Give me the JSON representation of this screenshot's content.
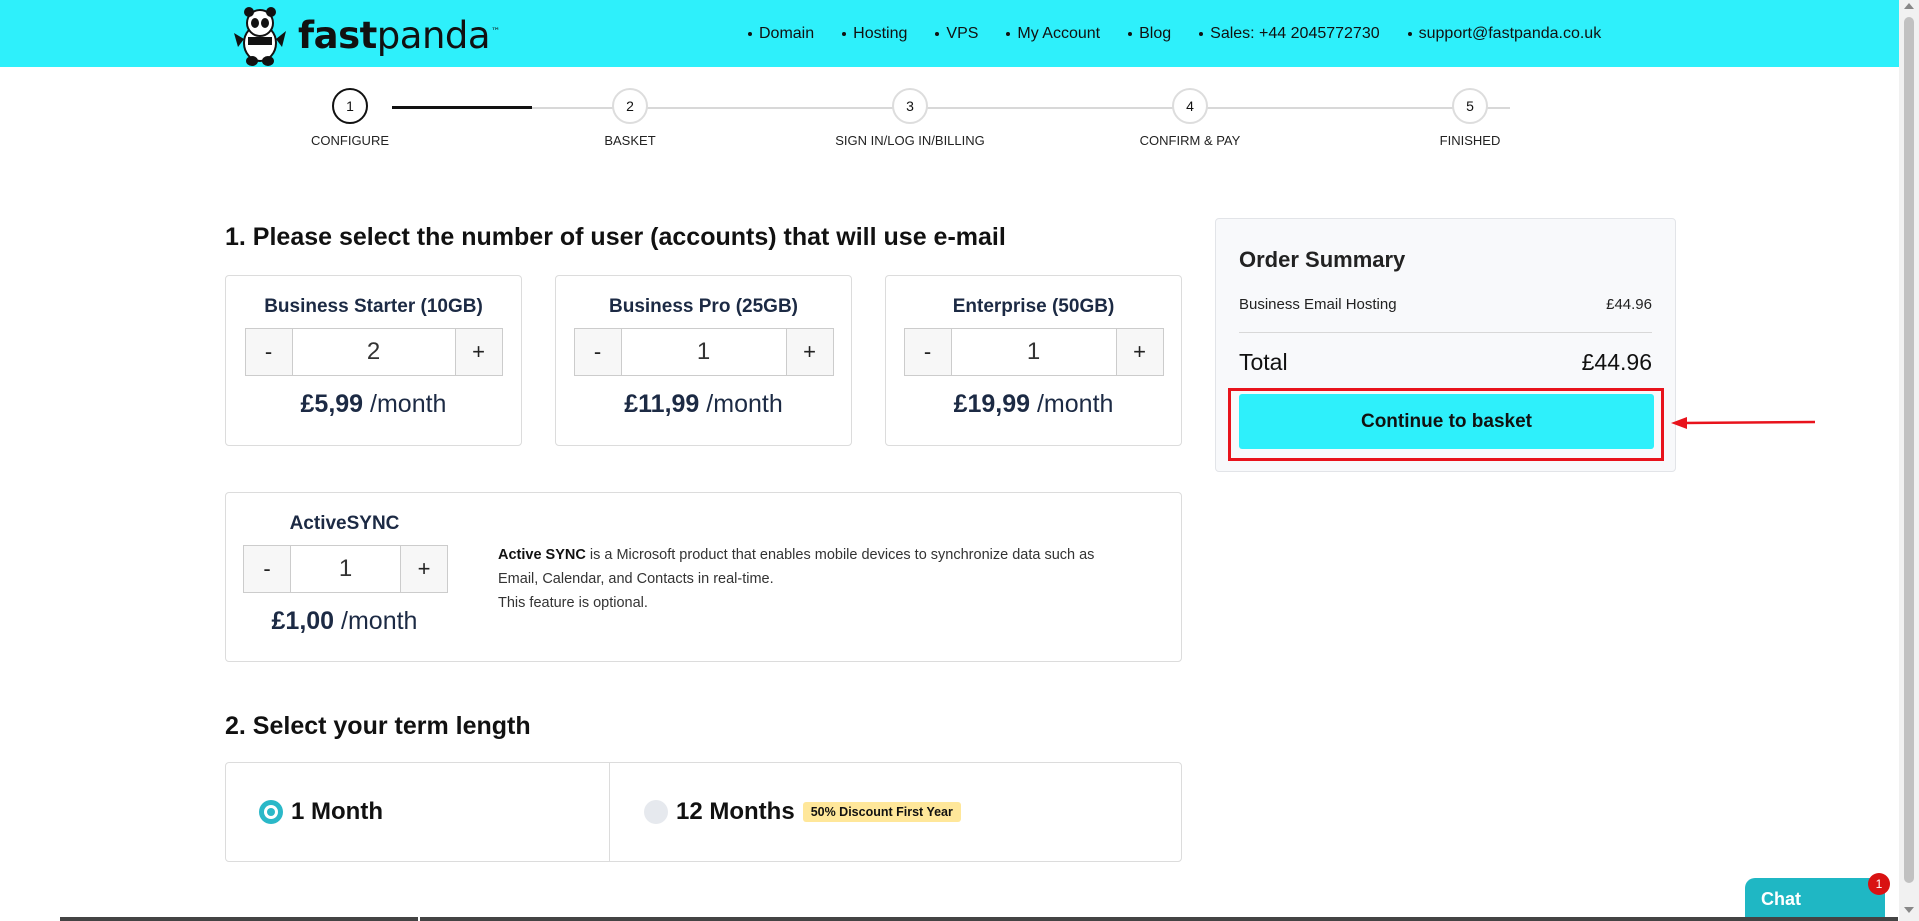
{
  "header": {
    "logo": {
      "bold": "fast",
      "regular": "panda",
      "tm": "™"
    },
    "nav": [
      {
        "label": "Domain"
      },
      {
        "label": "Hosting"
      },
      {
        "label": "VPS"
      },
      {
        "label": "My Account"
      },
      {
        "label": "Blog"
      },
      {
        "label": "Sales: +44 2045772730"
      },
      {
        "label": "support@fastpanda.co.uk"
      }
    ]
  },
  "steps": [
    {
      "num": "1",
      "label": "Configure"
    },
    {
      "num": "2",
      "label": "Basket"
    },
    {
      "num": "3",
      "label": "Sign in/Log in/Billing"
    },
    {
      "num": "4",
      "label": "Confirm & Pay"
    },
    {
      "num": "5",
      "label": "Finished"
    }
  ],
  "section1": {
    "title": "1. Please select the number of user (accounts) that will use e-mail"
  },
  "plans": [
    {
      "name": "Business Starter (10GB)",
      "qty": "2",
      "price": "£5,99",
      "period": "/month",
      "minus": "-",
      "plus": "+"
    },
    {
      "name": "Business Pro (25GB)",
      "qty": "1",
      "price": "£11,99",
      "period": "/month",
      "minus": "-",
      "plus": "+"
    },
    {
      "name": "Enterprise (50GB)",
      "qty": "1",
      "price": "£19,99",
      "period": "/month",
      "minus": "-",
      "plus": "+"
    }
  ],
  "activesync": {
    "name": "ActiveSYNC",
    "qty": "1",
    "price": "£1,00",
    "period": "/month",
    "minus": "-",
    "plus": "+",
    "desc_bold": "Active SYNC",
    "desc": " is a Microsoft product that enables mobile devices to synchronize data such as Email, Calendar, and Contacts in real-time.",
    "desc2": "This feature is optional."
  },
  "section2": {
    "title": "2. Select your term length"
  },
  "terms": [
    {
      "label": "1 Month",
      "selected": true
    },
    {
      "label": "12 Months",
      "selected": false,
      "badge": "50% Discount First Year"
    }
  ],
  "summary": {
    "title": "Order Summary",
    "item_name": "Business Email Hosting",
    "item_price": "£44.96",
    "total_label": "Total",
    "total_price": "£44.96",
    "cta": "Continue to basket"
  },
  "chat": {
    "label": "Chat",
    "badge": "1"
  },
  "colors": {
    "accent": "#2ef0fb",
    "highlight": "#e8131c",
    "chat": "#1fb7c4"
  }
}
